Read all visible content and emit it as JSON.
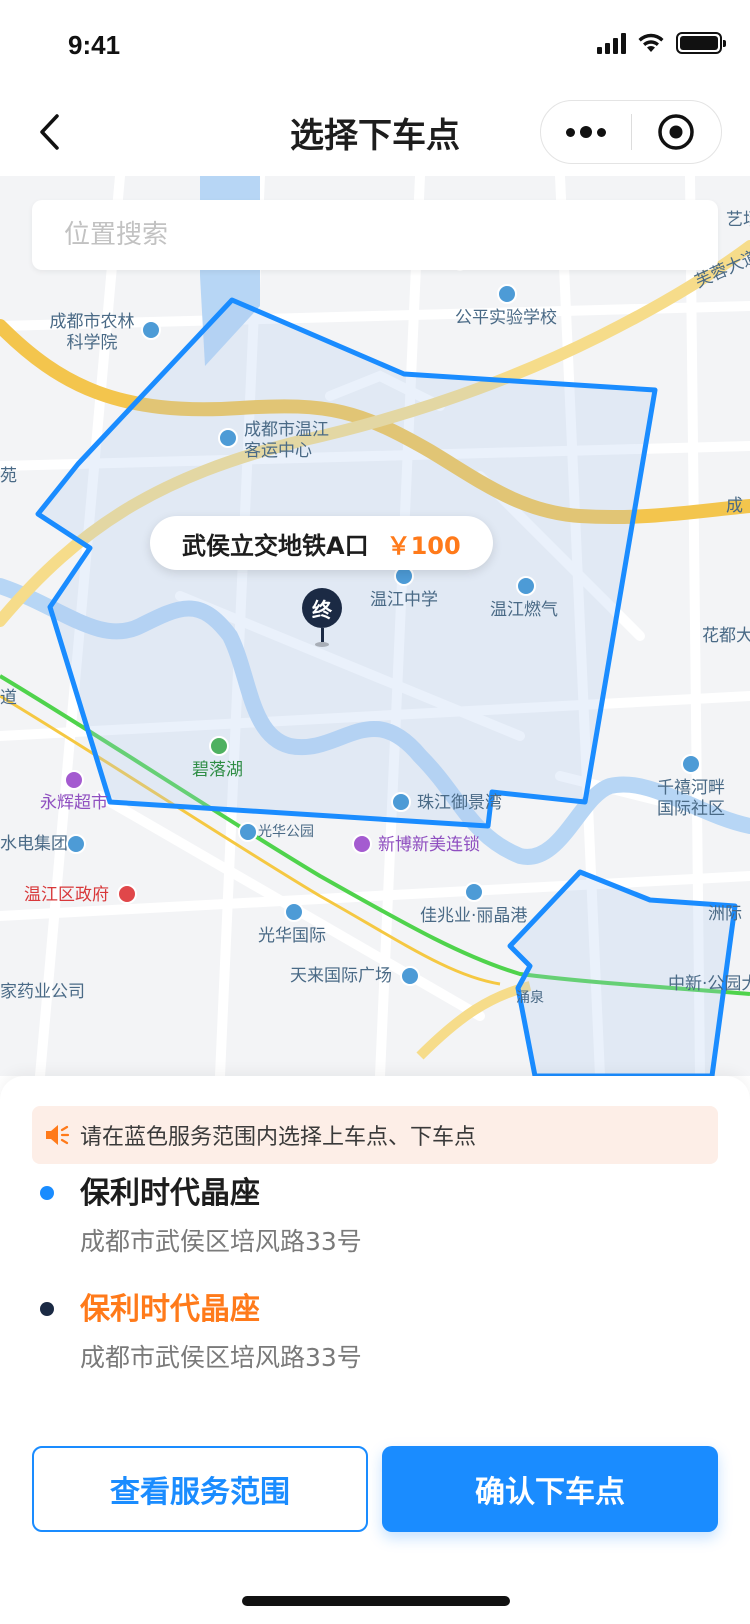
{
  "status_bar": {
    "time": "9:41"
  },
  "nav": {
    "title": "选择下车点"
  },
  "search": {
    "placeholder": "位置搜索"
  },
  "map": {
    "bubble": {
      "name": "武侯立交地铁A口",
      "price": "￥100"
    },
    "end_marker": "终",
    "labels": {
      "nongke": "成都市农林\n科学院",
      "gongping": "公平实验学校",
      "keyun": "成都市温江\n客运中心",
      "yuan": "苑",
      "wenjiang_middle": "温江中学",
      "wenjiang_gas": "温江燃气",
      "huadu": "花都大",
      "daoroad": "道",
      "biluohu": "碧落湖",
      "yonghui": "永辉超市",
      "zhujiang": "珠江御景湾",
      "qianxi": "千禧河畔\n国际社区",
      "shuidian": "水电集团",
      "guanghua_park": "光华公园",
      "xinbo": "新博新美连锁",
      "gov": "温江区政府",
      "jiazhao": "佳兆业·丽晶港",
      "guanghua_intl": "光华国际",
      "zhouji": "洲际",
      "tianlai": "天来国际广场",
      "zhongxin": "中新·公园大",
      "yaoye": "家药业公司",
      "yongquan": "涌泉",
      "furong": "芙蓉大道",
      "art": "艺场",
      "cheng": "成"
    }
  },
  "notice": {
    "text": "请在蓝色服务范围内选择上车点、下车点"
  },
  "pickup": {
    "name": "保利时代晶座",
    "address": "成都市武侯区培风路33号",
    "color": "#1a8cff"
  },
  "dropoff": {
    "name": "保利时代晶座",
    "address": "成都市武侯区培风路33号",
    "color": "#ff7a1a"
  },
  "buttons": {
    "view_service_area": "查看服务范围",
    "confirm_dropoff": "确认下车点"
  },
  "colors": {
    "accent": "#1a8cff",
    "price": "#ff7a1a",
    "notice_bg": "#fdeee7"
  }
}
